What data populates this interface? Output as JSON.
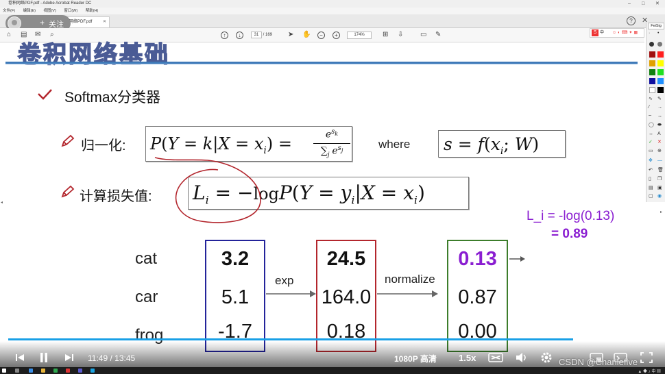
{
  "window": {
    "title": "卷积网络PDF.pdf - Adobe Acrobat Reader DC",
    "menu": [
      "文件(F)",
      "编辑(E)",
      "视图(V)",
      "窗口(W)",
      "帮助(H)"
    ]
  },
  "tabs": [
    {
      "label": "卷积网络PDF.pdf"
    }
  ],
  "follow": {
    "label": "关注",
    "plus": "+"
  },
  "toolbar": {
    "page_current": "31",
    "page_total": "/ 169",
    "zoom": "174%"
  },
  "ime": {
    "label": "中"
  },
  "palette": {
    "title": "FeiSig"
  },
  "slide": {
    "heading": "Softmax分类器",
    "normalize_label": "归一化:",
    "loss_label": "计算损失值:",
    "where": "where",
    "formula_prob": {
      "P": "P",
      "lp": "(",
      "Y": "Y",
      "eq1": " = ",
      "k": "k",
      "bar": "|",
      "X": "X",
      "eq2": " = ",
      "xi": "x",
      "i": "i",
      "rp": ")",
      "eq3": " = ",
      "num_e": "e",
      "num_s": "s",
      "num_k": "k",
      "den_sum": "∑",
      "den_j": "j",
      "den_e": "e",
      "den_s": "s",
      "den_j2": "j"
    },
    "formula_s": {
      "s": "s",
      "eq": " = ",
      "f": "f",
      "lp": "(",
      "x": "x",
      "i": "i",
      "semi": "; ",
      "W": "W",
      "rp": ")"
    },
    "formula_loss": {
      "L": "L",
      "i": "i",
      "eq": " = ",
      "neg": "−",
      "log": "log",
      "P": "P",
      "lp": "(",
      "Y": "Y",
      "eq2": " = ",
      "y": "y",
      "yi": "i",
      "bar": "|",
      "X": "X",
      "eq3": " = ",
      "x": "x",
      "xi": "i",
      "rp": ")"
    },
    "classes": [
      "cat",
      "car",
      "frog"
    ],
    "scores": [
      "3.2",
      "5.1",
      "-1.7"
    ],
    "exp_values": [
      "24.5",
      "164.0",
      "0.18"
    ],
    "normalized": [
      "0.13",
      "0.87",
      "0.00"
    ],
    "arrow_exp": "exp",
    "arrow_normalize": "normalize",
    "loss_line1": "L_i = -log(0.13)",
    "loss_line2": "= 0.89",
    "colors": {
      "score_box": "#23239a",
      "exp_box": "#b3262d",
      "norm_box": "#3c7d2b",
      "highlight": "#8a1ed1",
      "annotation": "#b3262d"
    }
  },
  "player": {
    "time": "11:49 / 13:45",
    "progress": 0.86,
    "quality": "1080P 高清",
    "speed": "1.5x"
  },
  "watermark": "CSDN @Charlieflve"
}
